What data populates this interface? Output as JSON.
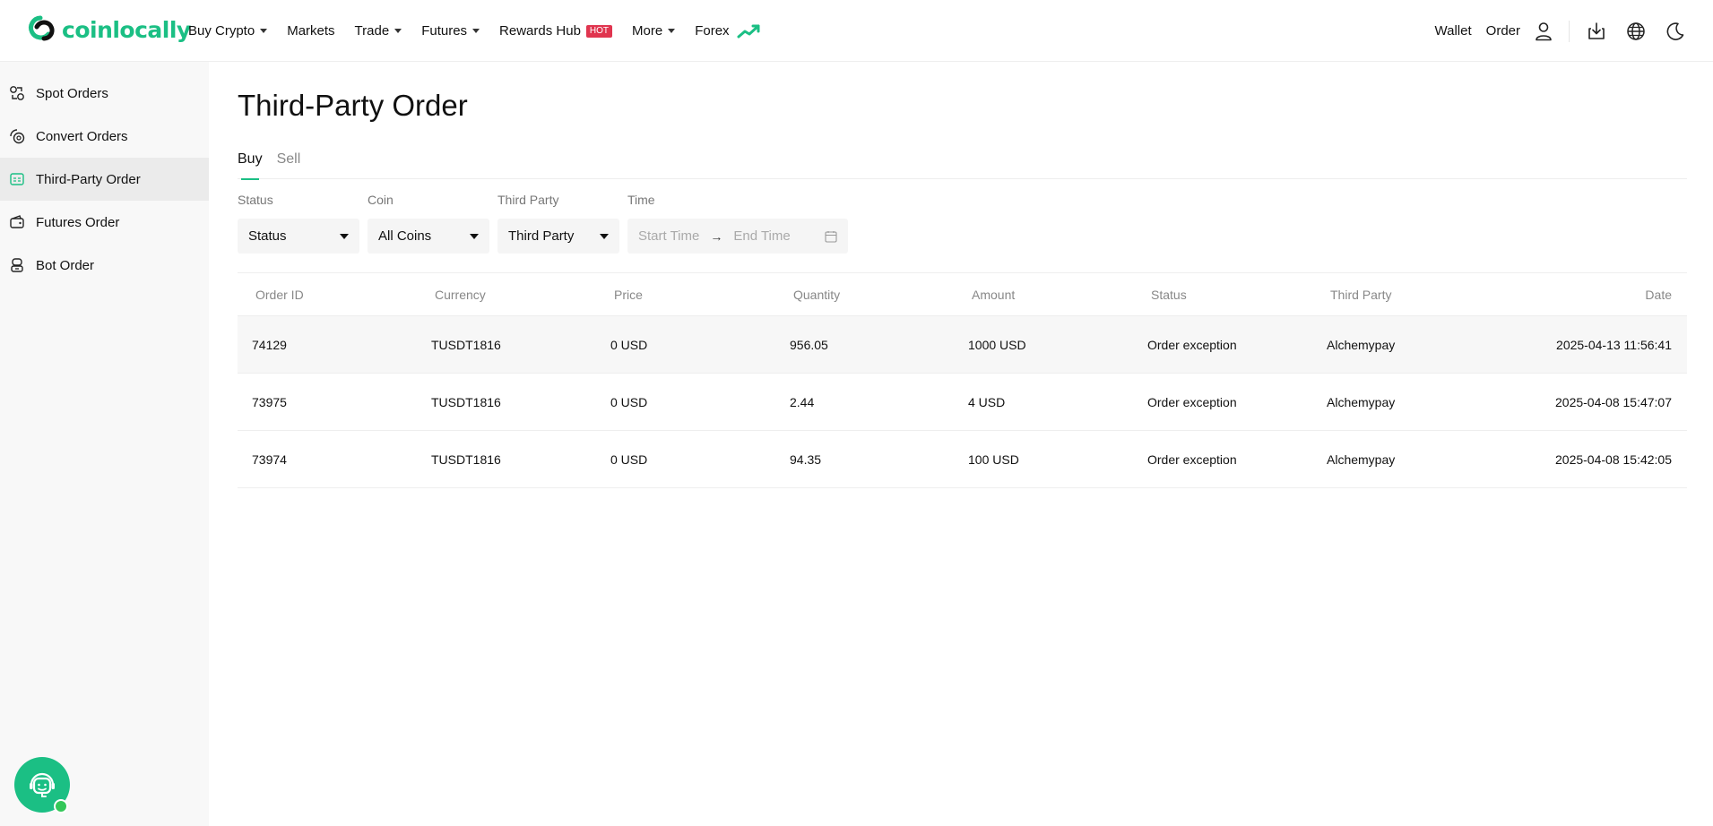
{
  "brand": {
    "name": "coinlocally",
    "color": "#1bbf84"
  },
  "nav": {
    "items": [
      {
        "label": "Buy Crypto",
        "dropdown": true
      },
      {
        "label": "Markets",
        "dropdown": false
      },
      {
        "label": "Trade",
        "dropdown": true
      },
      {
        "label": "Futures",
        "dropdown": true
      },
      {
        "label": "Rewards Hub",
        "dropdown": false,
        "badge": "HOT"
      },
      {
        "label": "More",
        "dropdown": true
      },
      {
        "label": "Forex",
        "dropdown": false,
        "icon": "trend-up-icon"
      }
    ],
    "wallet": "Wallet",
    "order": "Order",
    "icons": [
      "user-icon",
      "download-icon",
      "globe-icon",
      "moon-icon"
    ]
  },
  "sidebar": {
    "items": [
      {
        "label": "Spot Orders",
        "icon": "spot-orders-icon",
        "active": false
      },
      {
        "label": "Convert Orders",
        "icon": "convert-orders-icon",
        "active": false
      },
      {
        "label": "Third-Party Order",
        "icon": "third-party-order-icon",
        "active": true
      },
      {
        "label": "Futures Order",
        "icon": "wallet-icon",
        "active": false
      },
      {
        "label": "Bot Order",
        "icon": "bot-icon",
        "active": false
      }
    ]
  },
  "page": {
    "title": "Third-Party Order",
    "tabs": [
      {
        "label": "Buy",
        "active": true
      },
      {
        "label": "Sell",
        "active": false
      }
    ],
    "filters": {
      "status": {
        "label": "Status",
        "value": "Status"
      },
      "coin": {
        "label": "Coin",
        "value": "All Coins"
      },
      "third_party": {
        "label": "Third Party",
        "value": "Third Party"
      },
      "time": {
        "label": "Time",
        "start_placeholder": "Start Time",
        "end_placeholder": "End Time"
      }
    }
  },
  "table": {
    "columns": [
      "Order ID",
      "Currency",
      "Price",
      "Quantity",
      "Amount",
      "Status",
      "Third Party",
      "Date"
    ],
    "rows": [
      [
        "74129",
        "TUSDT1816",
        "0 USD",
        "956.05",
        "1000 USD",
        "Order exception",
        "Alchemypay",
        "2025-04-13 11:56:41"
      ],
      [
        "73975",
        "TUSDT1816",
        "0 USD",
        "2.44",
        "4 USD",
        "Order exception",
        "Alchemypay",
        "2025-04-08 15:47:07"
      ],
      [
        "73974",
        "TUSDT1816",
        "0 USD",
        "94.35",
        "100 USD",
        "Order exception",
        "Alchemypay",
        "2025-04-08 15:42:05"
      ]
    ]
  }
}
